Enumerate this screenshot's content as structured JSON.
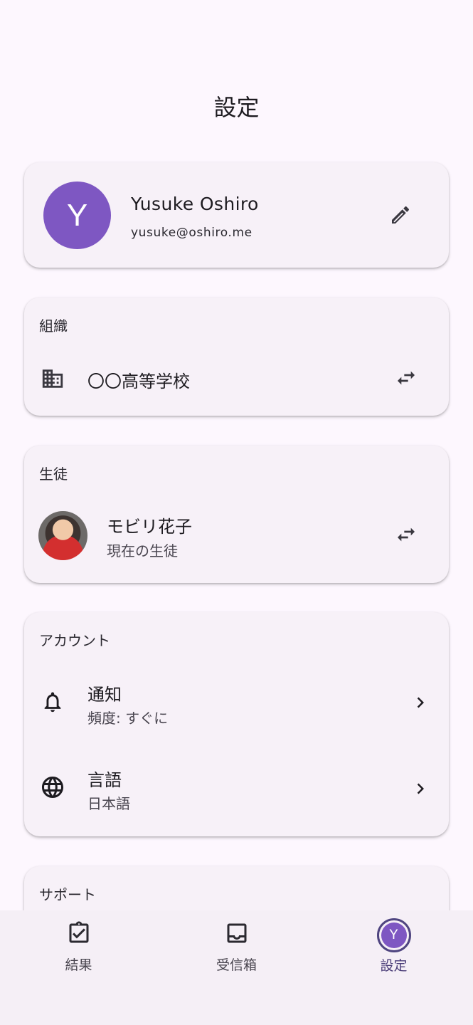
{
  "header": {
    "title": "設定"
  },
  "profile": {
    "avatar_letter": "Y",
    "name": "Yusuke Oshiro",
    "email": "yusuke@oshiro.me",
    "edit_icon": "pencil-icon",
    "avatar_color": "#7e57c2"
  },
  "organization": {
    "header": "組織",
    "name": "〇〇高等学校",
    "icon": "building-icon",
    "action_icon": "swap-icon"
  },
  "student": {
    "header": "生徒",
    "name": "モビリ花子",
    "subtitle": "現在の生徒",
    "action_icon": "swap-icon"
  },
  "account": {
    "header": "アカウント",
    "items": [
      {
        "title": "通知",
        "subtitle": "頻度: すぐに",
        "icon": "bell-icon"
      },
      {
        "title": "言語",
        "subtitle": "日本語",
        "icon": "globe-icon"
      }
    ]
  },
  "support": {
    "header": "サポート"
  },
  "bottom_nav": {
    "items": [
      {
        "label": "結果",
        "icon": "clipboard-check-icon"
      },
      {
        "label": "受信箱",
        "icon": "inbox-icon"
      },
      {
        "label": "設定",
        "icon": "avatar",
        "avatar_letter": "Y",
        "active": true
      }
    ]
  }
}
